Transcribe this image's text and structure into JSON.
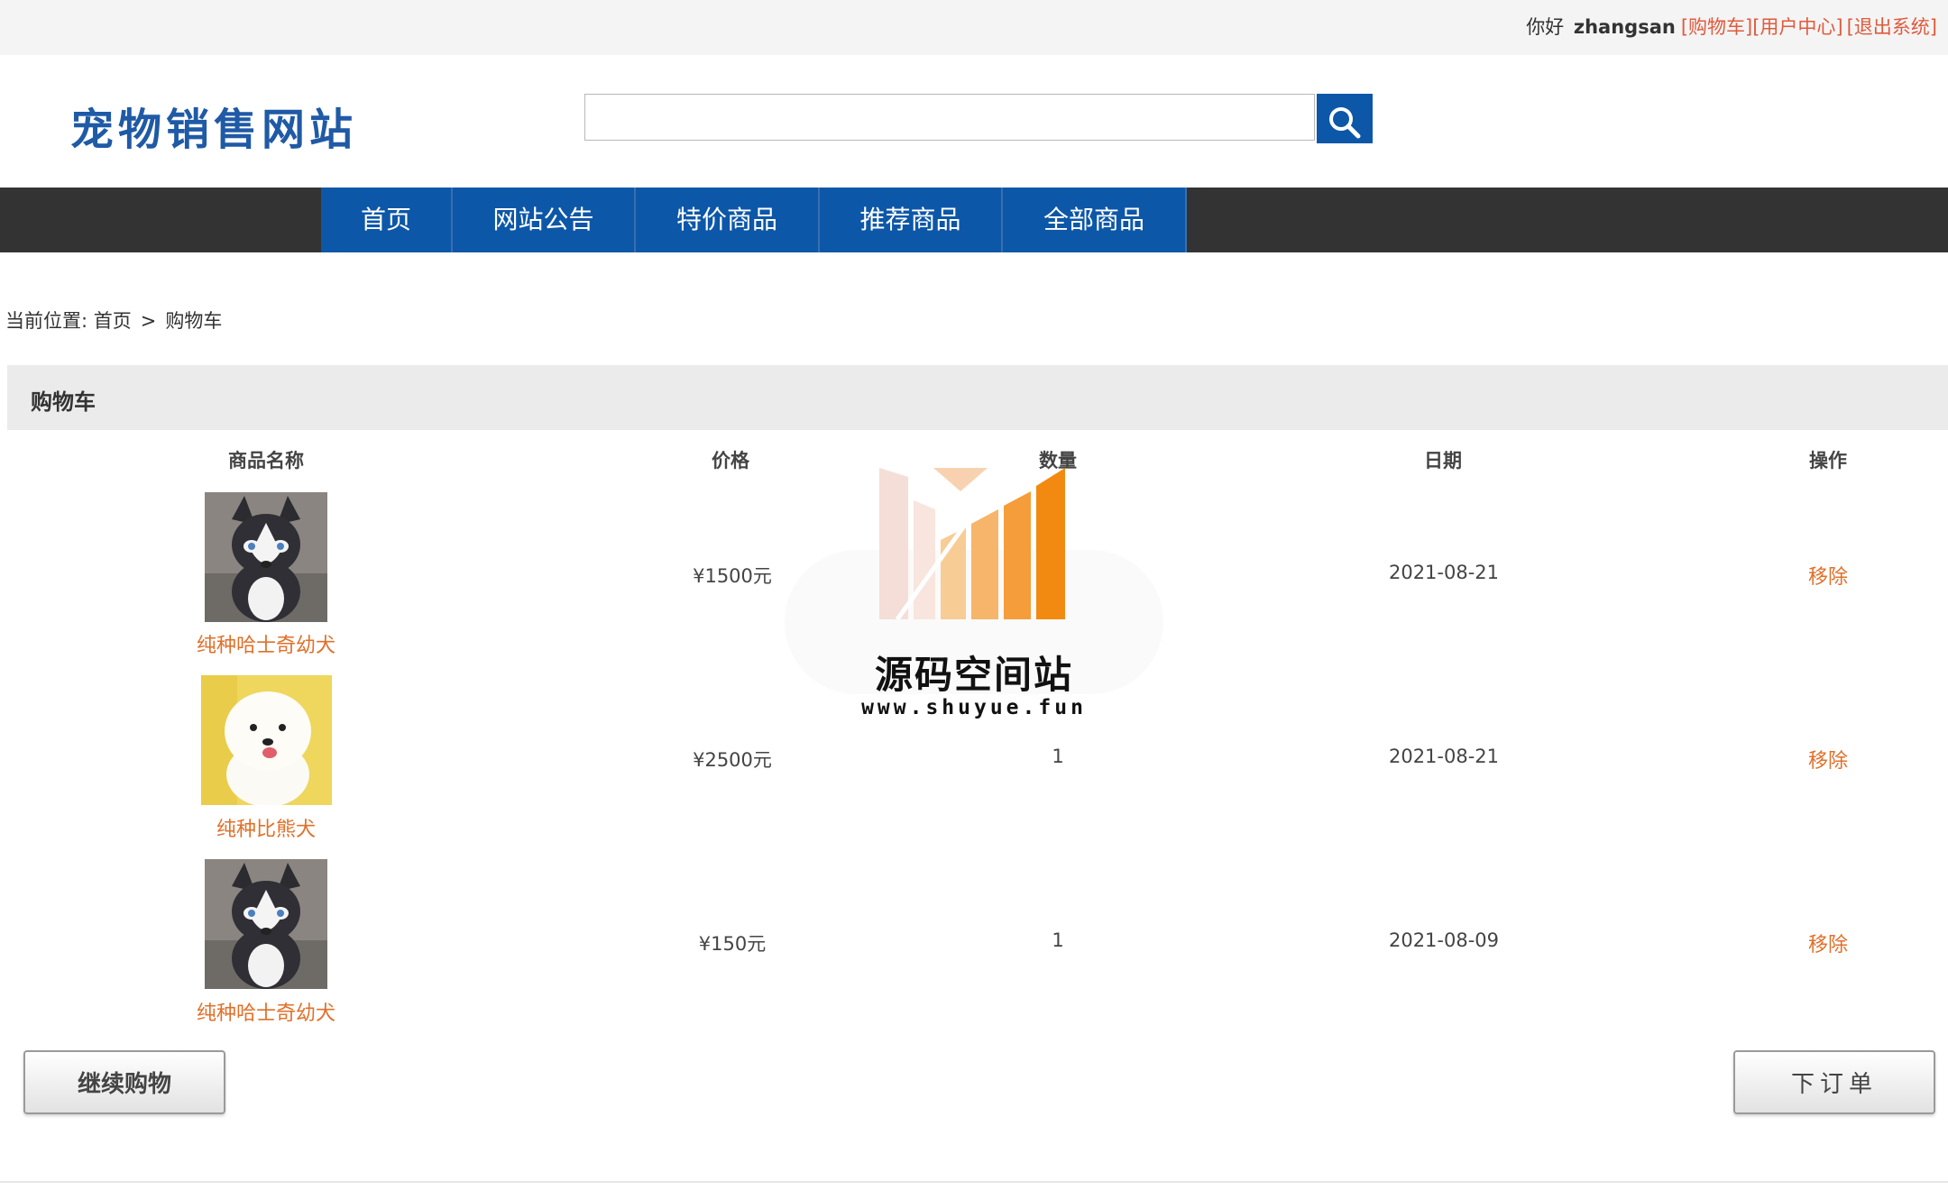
{
  "topbar": {
    "greeting": "你好",
    "username": "zhangsan",
    "links": [
      "[购物车]",
      "[用户中心]",
      "[退出系统]"
    ],
    "link_color": "#e05a3c"
  },
  "header": {
    "logo_text": "宠物销售网站",
    "search": {
      "value": "",
      "placeholder": "",
      "icon": "search-icon"
    }
  },
  "nav": {
    "items": [
      "首页",
      "网站公告",
      "特价商品",
      "推荐商品",
      "全部商品"
    ],
    "active_color": "#0d57a8",
    "bar_color": "#333333"
  },
  "breadcrumb": {
    "prefix": "当前位置: 首页",
    "separator": ">",
    "current": "购物车"
  },
  "cart": {
    "title": "购物车",
    "columns": [
      "商品名称",
      "价格",
      "数量",
      "日期",
      "操作"
    ],
    "rows": [
      {
        "name": "纯种哈士奇幼犬",
        "image": "husky-puppy-photo",
        "price": "¥1500元",
        "qty": "",
        "date": "2021-08-21",
        "action": "移除"
      },
      {
        "name": "纯种比熊犬",
        "image": "bichon-photo",
        "price": "¥2500元",
        "qty": "1",
        "date": "2021-08-21",
        "action": "移除"
      },
      {
        "name": "纯种哈士奇幼犬",
        "image": "husky-puppy-photo",
        "price": "¥150元",
        "qty": "1",
        "date": "2021-08-09",
        "action": "移除"
      }
    ],
    "link_color": "#e0702a"
  },
  "buttons": {
    "continue_label": "继续购物",
    "order_label": "下订单"
  },
  "watermark": {
    "title": "源码空间站",
    "url": "www.shuyue.fun"
  }
}
